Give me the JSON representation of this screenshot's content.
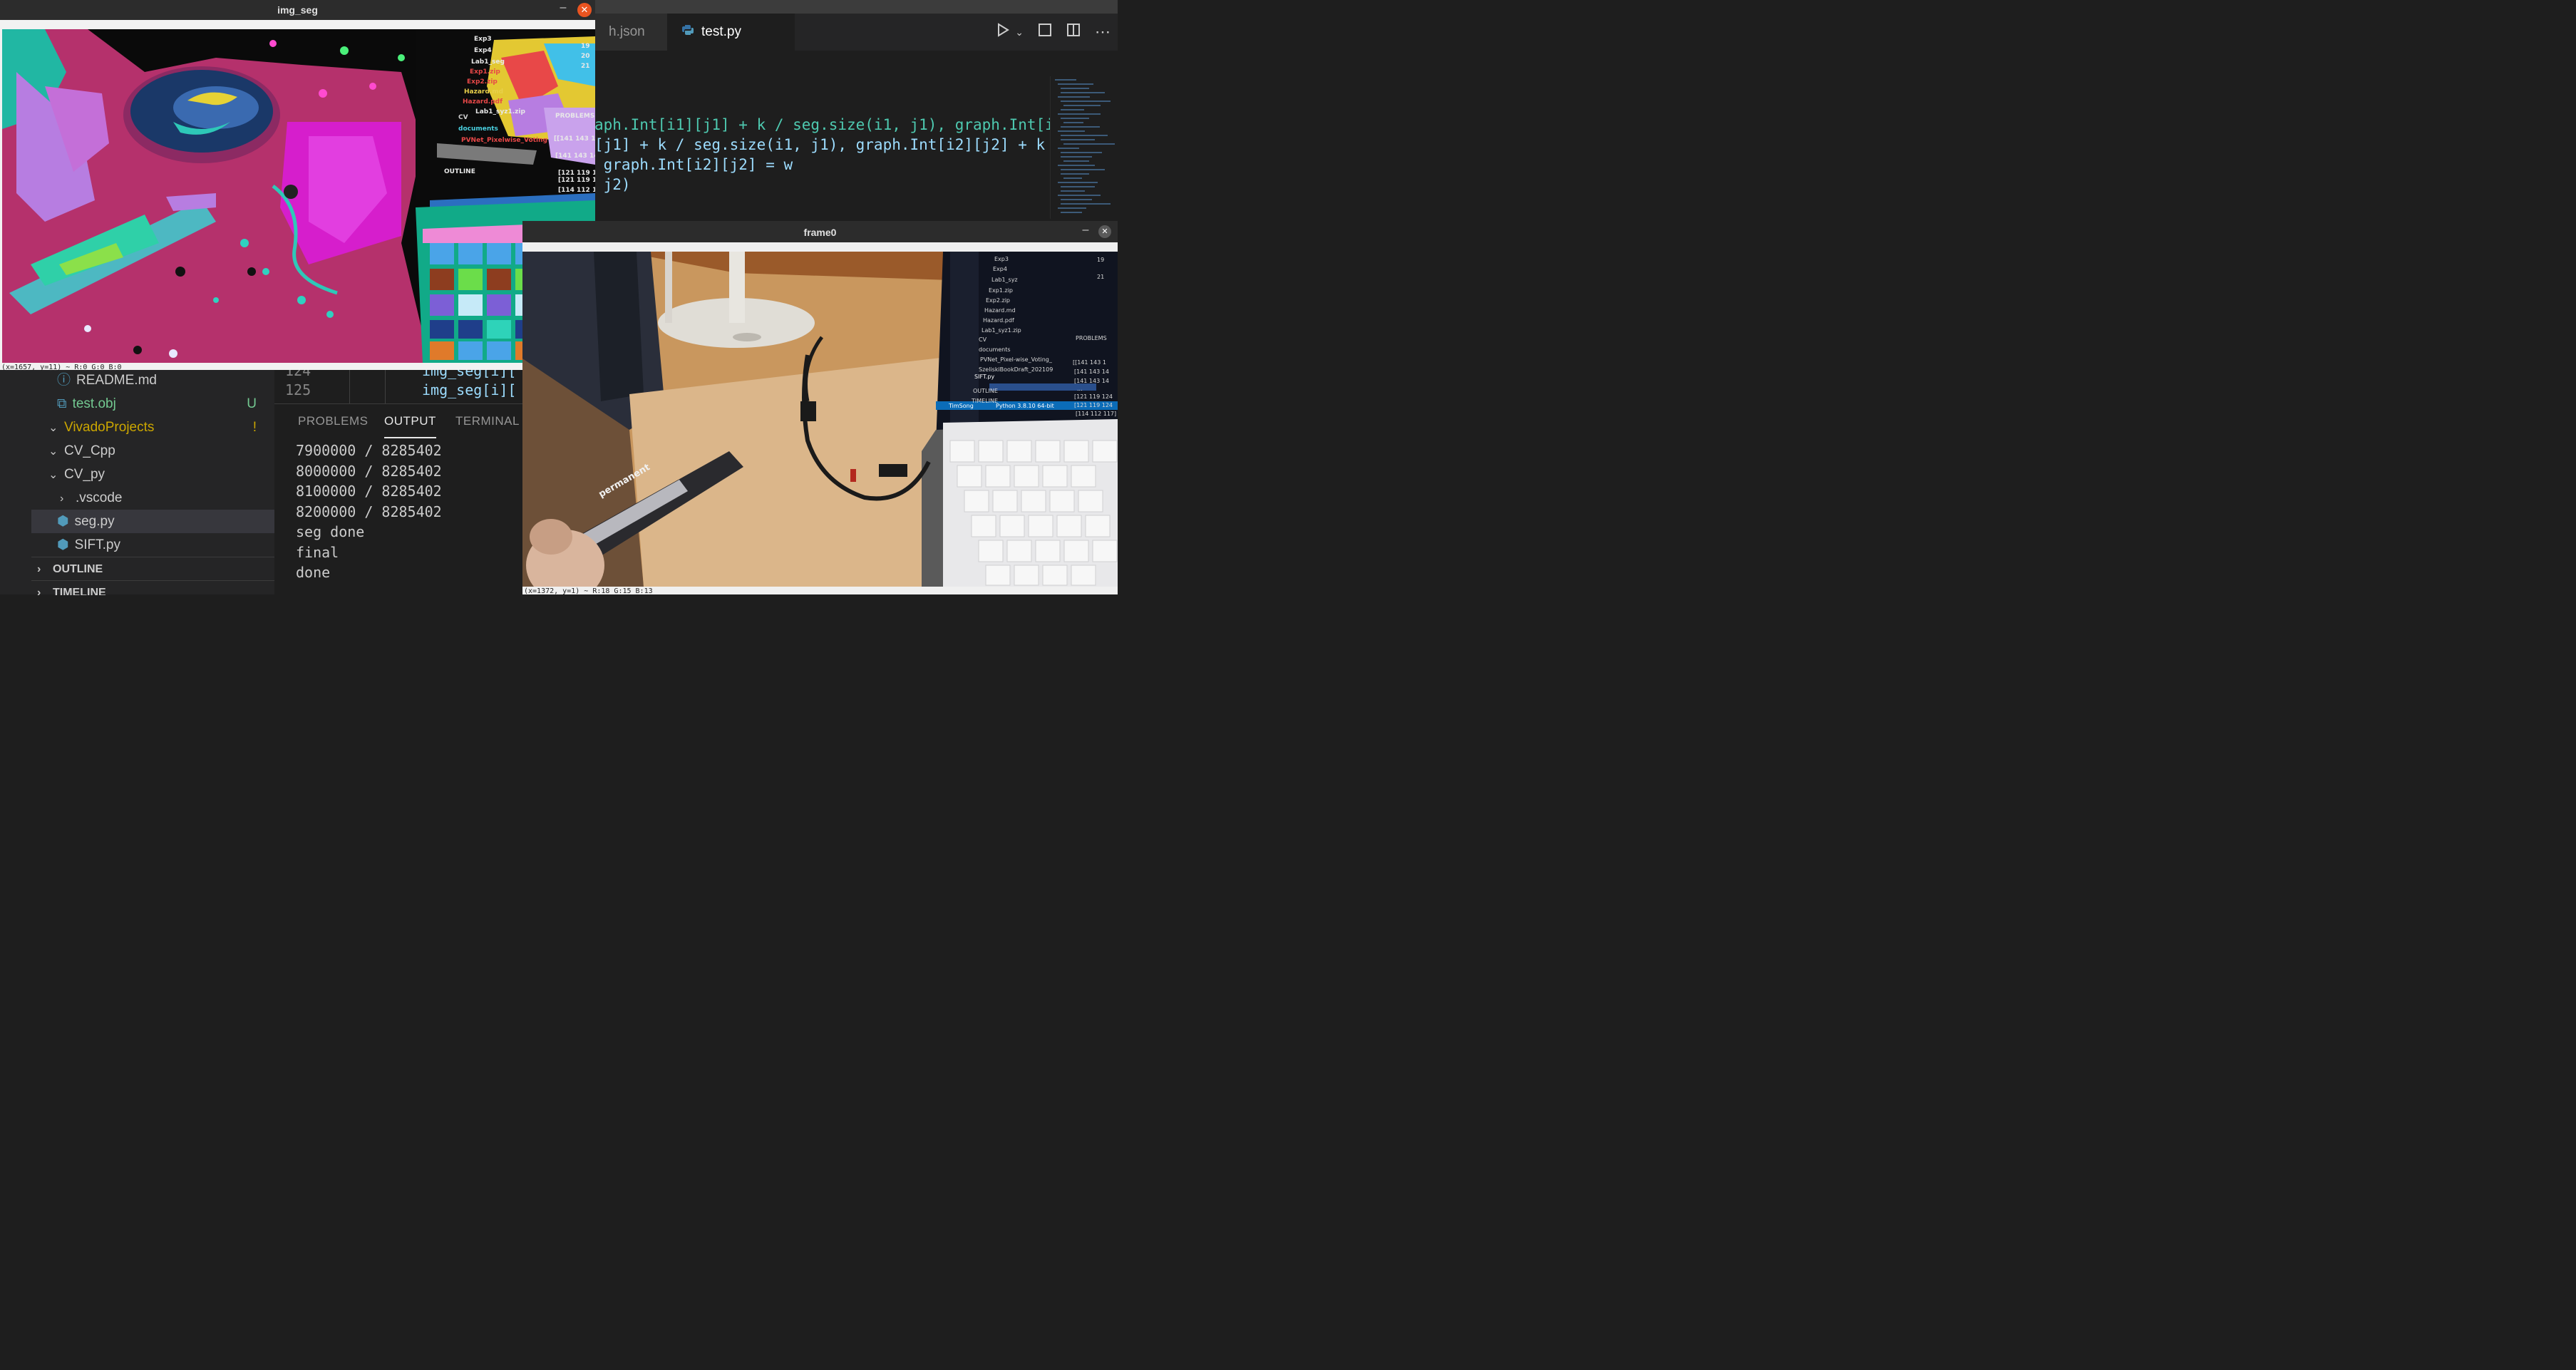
{
  "vscode": {
    "tabs": [
      {
        "label": "h.json",
        "active": false
      },
      {
        "label": "test.py",
        "active": true
      }
    ],
    "code_lines": [
      "aph.Int[i1][j1] + k / seg.size(i1, j1), graph.Int[i",
      "[j1] + k / seg.size(i1, j1), graph.Int[i2][j2] + k",
      " graph.Int[i2][j2] = w",
      " j2)"
    ],
    "gutter": {
      "line_124": "124",
      "line_125": "125",
      "code_124": "img_seg[i][",
      "code_125": "img_seg[i]["
    },
    "explorer": {
      "items": [
        {
          "label": "README.md"
        },
        {
          "label": "test.obj",
          "badge": "U"
        },
        {
          "label": "VivadoProjects",
          "badge": "!"
        },
        {
          "label": "CV_Cpp"
        },
        {
          "label": "CV_py"
        },
        {
          "label": ".vscode"
        },
        {
          "label": "seg.py"
        },
        {
          "label": "SIFT.py"
        }
      ],
      "outline": "OUTLINE",
      "timeline": "TIMELINE"
    },
    "panel": {
      "tabs": [
        "PROBLEMS",
        "OUTPUT",
        "TERMINAL"
      ],
      "output": [
        "7900000 / 8285402",
        "8000000 / 8285402",
        "8100000 / 8285402",
        "8200000 / 8285402",
        "seg done",
        "final",
        "done"
      ]
    }
  },
  "img_seg_window": {
    "title": "img_seg",
    "status": "(x=1657, y=11) ~ R:0 G:0 B:0",
    "overlay_text": {
      "exp3": "Exp3",
      "exp4": "Exp4",
      "lab1": "Lab1_seg",
      "exp1": "Exp1.zip",
      "exp2": "Exp2.zip",
      "hazard_md": "Hazard.md",
      "hazard_pdf": "Hazard.pdf",
      "lab1zip": "Lab1_syz1.zip",
      "cv": "CV",
      "documents": "documents",
      "pvnet": "PVNet_Pixelwise_Voting",
      "outline": "OUTLINE",
      "problems": "PROBLEMS",
      "m1": "[[141 143 1",
      "m2": "[141 143 14",
      "m3": "[121 119 124",
      "m4": "[121 119 124",
      "m5": "[114 112 17]]",
      "n1": "19",
      "n2": "20",
      "n3": "21"
    }
  },
  "frame0_window": {
    "title": "frame0",
    "status": "(x=1372, y=1) ~ R:18 G:15 B:13",
    "overlay_text": {
      "f_exp3": "Exp3",
      "f_exp4": "Exp4",
      "f_lab1": "Lab1_syz",
      "f_exp1": "Exp1.zip",
      "f_exp2": "Exp2.zip",
      "f_hazmd": "Hazard.md",
      "f_hazpdf": "Hazard.pdf",
      "f_lab1zip": "Lab1_syz1.zip",
      "f_cv": "CV",
      "f_docs": "documents",
      "f_pvnet": "PVNet_Pixel-wise_Voting_",
      "f_szel": "SzeliskiBookDraft_202109",
      "f_sift": "SIFT.py",
      "f_outline": "OUTLINE",
      "f_timeline": "TIMELINE",
      "f_problems": "PROBLEMS",
      "f_m1": "[[141 143 1",
      "f_m2": "[141 143 14",
      "f_m3": "[141 143 14",
      "f_m4": "...",
      "f_m5": "[121 119 124",
      "f_m6": "[121 119 124",
      "f_m7": "[114 112 117]",
      "f_n1": "19",
      "f_n2": "21",
      "f_status": "Python 3.8.10 64-bit",
      "f_status2": "TimSong",
      "f_pen": "permanent"
    }
  },
  "colors": {
    "accent_close": "#e95420",
    "git_untracked": "#73c991",
    "git_warning": "#cca700"
  }
}
